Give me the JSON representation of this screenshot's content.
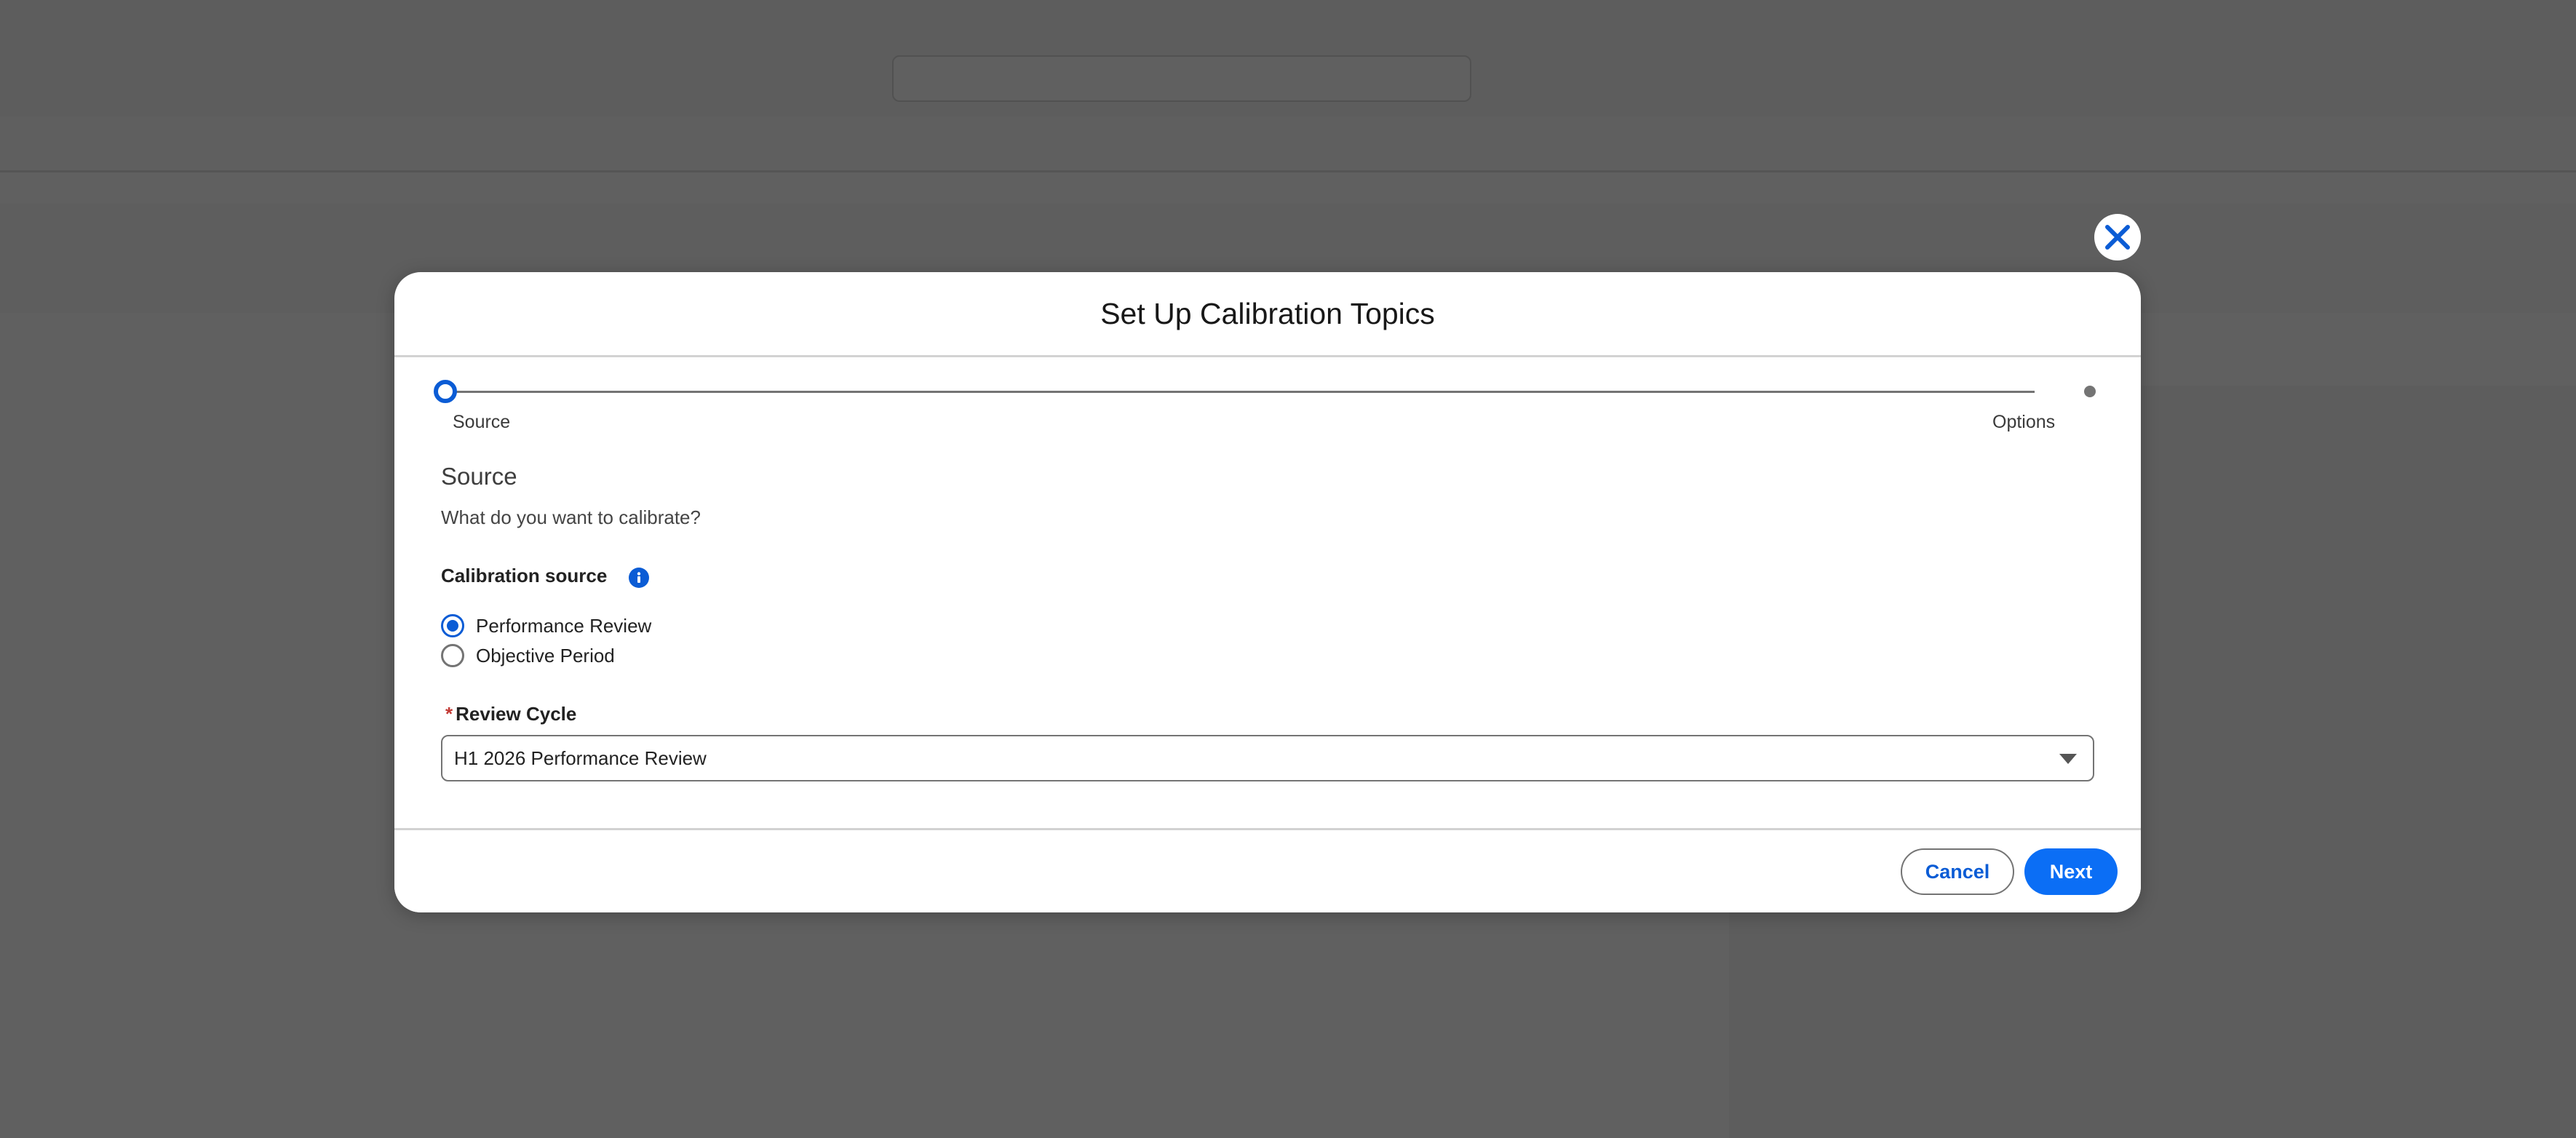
{
  "modal": {
    "title": "Set Up Calibration Topics",
    "steps": [
      {
        "label": "Source"
      },
      {
        "label": "Options"
      }
    ],
    "section_title": "Source",
    "section_subtitle": "What do you want to calibrate?",
    "calibration_source": {
      "label": "Calibration source",
      "options": [
        {
          "label": "Performance Review",
          "selected": true
        },
        {
          "label": "Objective Period",
          "selected": false
        }
      ]
    },
    "review_cycle": {
      "required_marker": "*",
      "label": "Review Cycle",
      "value": "H1 2026 Performance Review"
    },
    "footer": {
      "cancel_label": "Cancel",
      "next_label": "Next"
    }
  },
  "colors": {
    "brand_blue": "#0b5cd5",
    "next_button": "#0b6ef5",
    "required_red": "#c23934"
  }
}
